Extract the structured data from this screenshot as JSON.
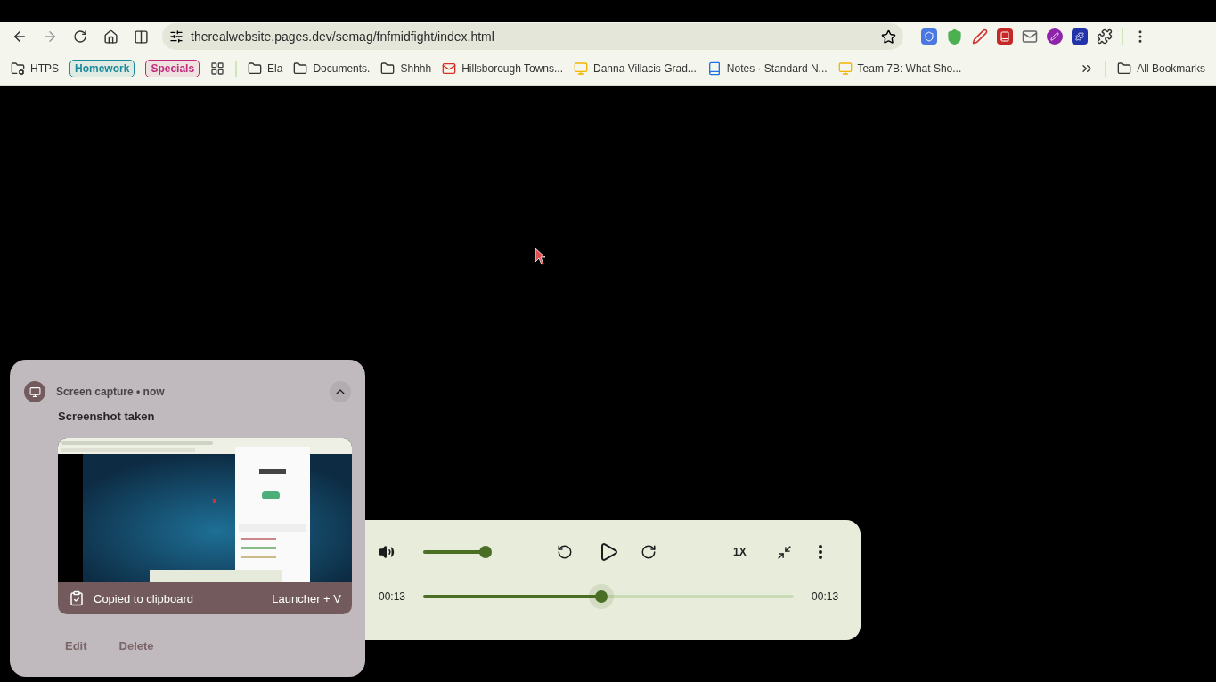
{
  "toolbar": {
    "url": "therealwebsite.pages.dev/semag/fnfmidfight/index.html"
  },
  "bookmarks": [
    {
      "kind": "folder-gear",
      "label": "HTPS"
    },
    {
      "kind": "chip",
      "label": "Homework",
      "color": "#1a8a9a"
    },
    {
      "kind": "chip",
      "label": "Specials",
      "color": "#c0287a"
    },
    {
      "kind": "apps"
    },
    {
      "kind": "folder",
      "label": "Ela"
    },
    {
      "kind": "folder",
      "label": "Documents."
    },
    {
      "kind": "folder",
      "label": "Shhhh"
    },
    {
      "kind": "mail",
      "label": "Hillsborough Towns..."
    },
    {
      "kind": "slides",
      "label": "Danna Villacis Grad..."
    },
    {
      "kind": "notes",
      "label": "Notes · Standard N..."
    },
    {
      "kind": "slides",
      "label": "Team 7B: What Sho..."
    }
  ],
  "all_bookmarks": "All Bookmarks",
  "notification": {
    "app": "Screen capture",
    "separator": "•",
    "time": "now",
    "title": "Screenshot taken",
    "expanded": true,
    "banner": "Copied to clipboard",
    "shortcut": "Launcher + V",
    "actions": [
      "Edit",
      "Delete"
    ]
  },
  "player": {
    "volume": {
      "level": 1
    },
    "playing": false,
    "speed": "1X",
    "elapsed": "00:13",
    "duration": "00:13",
    "progress": {
      "level": 0.48
    }
  }
}
